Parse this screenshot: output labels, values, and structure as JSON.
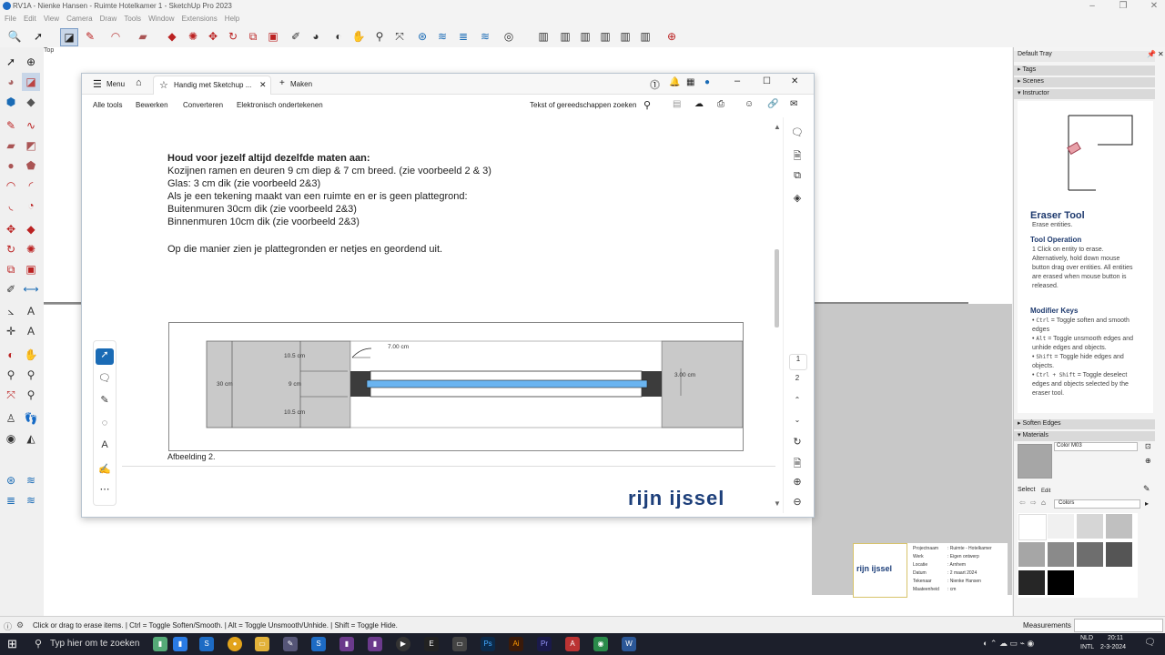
{
  "window": {
    "title": "RV1A - Nienke Hansen - Ruimte Hotelkamer 1 - SketchUp Pro 2023",
    "buttons": [
      "–",
      "❐",
      "✕"
    ]
  },
  "menubar": [
    "File",
    "Edit",
    "View",
    "Camera",
    "Draw",
    "Tools",
    "Window",
    "Extensions",
    "Help"
  ],
  "canvas": {
    "view_label": "Top"
  },
  "pdf": {
    "menu_label": "Menu",
    "home_icon": "home-icon",
    "tab_title": "Handig met Sketchup ...",
    "new_tab_label": "Maken",
    "menu_items": [
      "Alle tools",
      "Bewerken",
      "Converteren",
      "Elektronisch ondertekenen"
    ],
    "search_placeholder": "Tekst of gereedschappen zoeken",
    "doc": {
      "heading": "Houd voor jezelf altijd dezelfde maten aan:",
      "lines": [
        "Kozijnen ramen en deuren 9 cm diep & 7 cm breed. (zie voorbeeld 2 & 3)",
        "Glas: 3 cm dik (zie voorbeeld 2&3)",
        "Als je een tekening maakt van een ruimte en er is geen plattegrond:",
        "Buitenmuren 30cm dik (zie voorbeeld 2&3)",
        "Binnenmuren 10cm dik (zie voorbeeld 2&3)"
      ],
      "closing": "Op die manier zien je plattegronden er netjes en geordend uit.",
      "figure": {
        "dims": {
          "top": "10.5 cm",
          "middle": "9 cm",
          "bottom": "10.5 cm",
          "wall": "30 cm",
          "frame": "7.00 cm",
          "glass": "3.00 cm"
        },
        "caption": "Afbeelding 2."
      },
      "logo_text": "rijn ijssel"
    },
    "page_numbers": [
      "1",
      "2"
    ]
  },
  "tray": {
    "title": "Default Tray",
    "sections": [
      "Tags",
      "Scenes",
      "Instructor"
    ],
    "instructor": {
      "tool_name": "Eraser Tool",
      "tool_desc": "Erase entities.",
      "operation_title": "Tool Operation",
      "operation_text": "1  Click on entity to erase. Alternatively, hold down mouse button drag over entities. All entities are erased when mouse button is released.",
      "modifier_title": "Modifier Keys",
      "modifiers": [
        {
          "key": "Ctrl",
          "text": " = Toggle soften and smooth edges"
        },
        {
          "key": "Alt",
          "text": " = Toggle unsmooth edges and unhide edges and objects."
        },
        {
          "key": "Shift",
          "text": " = Toggle hide edges and objects."
        },
        {
          "key": "Ctrl + Shift",
          "text": " = Toggle deselect edges and objects selected by the eraser tool."
        }
      ]
    },
    "soften_edges": "Soften Edges",
    "materials": "Materials",
    "material_name": "Color M03",
    "select_tab": "Select",
    "edit_tab": "Edit",
    "library": "Colors",
    "swatch_colors": [
      "#ffffff",
      "#f0f0f0",
      "#d6d6d6",
      "#c0c0c0",
      "#a6a6a6",
      "#8a8a8a",
      "#6e6e6e",
      "#555555",
      "#3b3b3b",
      "#262626",
      "#111111",
      "#000000"
    ]
  },
  "titleblock": {
    "logo_text": "rijn ijssel",
    "rows": [
      {
        "label": "Projectnaam",
        "value": ": Ruimte - Hotelkamer"
      },
      {
        "label": "Werk",
        "value": ": Eigen ontwerp"
      },
      {
        "label": "Locatie",
        "value": ": Arnhem"
      },
      {
        "label": "Datum",
        "value": ": 2 maart 2024"
      },
      {
        "label": "Tekenaar",
        "value": ": Nienke Hansen"
      },
      {
        "label": "Maateenheid",
        "value": ": cm"
      }
    ]
  },
  "status": {
    "hint": "Click or drag to erase items. | Ctrl = Toggle Soften/Smooth. | Alt = Toggle Unsmooth/Unhide. | Shift = Toggle Hide.",
    "measurements_label": "Measurements"
  },
  "taskbar": {
    "search_placeholder": "Typ hier om te zoeken",
    "lang_top": "NLD",
    "lang_bottom": "INTL",
    "time": "20:11",
    "date": "2-3-2024"
  }
}
